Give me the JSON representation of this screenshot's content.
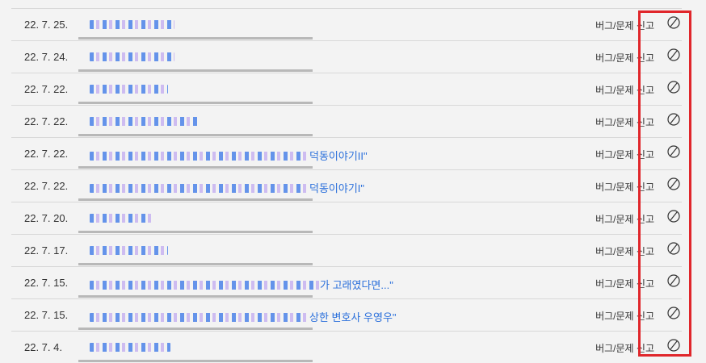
{
  "colors": {
    "title_link": "#2a6fdb",
    "highlight": "#e0262b",
    "progress": "#b8b8b8"
  },
  "rows": [
    {
      "date": "22. 7. 25.",
      "title_visible": "",
      "report_label": "버그/문제 신고",
      "icon": "block-icon",
      "progress": 1.0
    },
    {
      "date": "22. 7. 24.",
      "title_visible": "",
      "report_label": "버그/문제 신고",
      "icon": "block-icon",
      "progress": 1.0
    },
    {
      "date": "22. 7. 22.",
      "title_visible": "",
      "report_label": "버그/문제 신고",
      "icon": "block-icon",
      "progress": 1.0
    },
    {
      "date": "22. 7. 22.",
      "title_visible": "",
      "report_label": "버그/문제 신고",
      "icon": "block-icon",
      "progress": 1.0
    },
    {
      "date": "22. 7. 22.",
      "title_visible": "덕동이야기II\"",
      "report_label": "버그/문제 신고",
      "icon": "block-icon",
      "progress": 1.0
    },
    {
      "date": "22. 7. 22.",
      "title_visible": "덕동이야기I\"",
      "report_label": "버그/문제 신고",
      "icon": "block-icon",
      "progress": 1.0
    },
    {
      "date": "22. 7. 20.",
      "title_visible": "",
      "report_label": "버그/문제 신고",
      "icon": "block-icon",
      "progress": 1.0
    },
    {
      "date": "22. 7. 17.",
      "title_visible": "",
      "report_label": "버그/문제 신고",
      "icon": "block-icon",
      "progress": 1.0
    },
    {
      "date": "22. 7. 15.",
      "title_visible": "가 고래였다면...\"",
      "report_label": "버그/문제 신고",
      "icon": "block-icon",
      "progress": 1.0
    },
    {
      "date": "22. 7. 15.",
      "title_visible": "상한 변호사 우영우\"",
      "report_label": "버그/문제 신고",
      "icon": "block-icon",
      "progress": 1.0
    },
    {
      "date": "22. 7. 4.",
      "title_visible": "",
      "report_label": "버그/문제 신고",
      "icon": "block-icon",
      "progress": 1.0
    }
  ]
}
